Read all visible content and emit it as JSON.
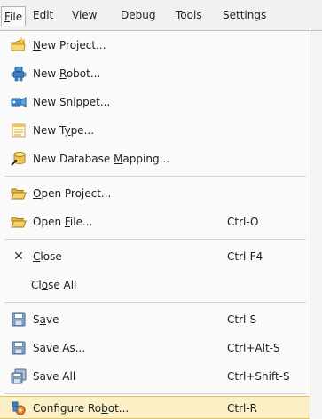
{
  "menubar": {
    "items": [
      {
        "pre": "",
        "m": "F",
        "post": "ile"
      },
      {
        "pre": "",
        "m": "E",
        "post": "dit"
      },
      {
        "pre": "",
        "m": "V",
        "post": "iew"
      },
      {
        "pre": "",
        "m": "D",
        "post": "ebug"
      },
      {
        "pre": "",
        "m": "T",
        "post": "ools"
      },
      {
        "pre": "",
        "m": "S",
        "post": "ettings"
      }
    ]
  },
  "file_menu": {
    "items": [
      {
        "icon": "new-project-icon",
        "pre": "",
        "m": "N",
        "post": "ew Project...",
        "shortcut": ""
      },
      {
        "icon": "new-robot-icon",
        "pre": "New ",
        "m": "R",
        "post": "obot...",
        "shortcut": ""
      },
      {
        "icon": "new-snippet-icon",
        "pre": "New Snippet...",
        "m": "",
        "post": "",
        "shortcut": ""
      },
      {
        "icon": "new-type-icon",
        "pre": "New T",
        "m": "y",
        "post": "pe...",
        "shortcut": ""
      },
      {
        "icon": "new-database-mapping-icon",
        "pre": "New Database ",
        "m": "M",
        "post": "apping...",
        "shortcut": ""
      },
      {
        "icon": "open-folder-icon",
        "pre": "",
        "m": "O",
        "post": "pen Project...",
        "shortcut": ""
      },
      {
        "icon": "open-folder-icon",
        "pre": "Open ",
        "m": "F",
        "post": "ile...",
        "shortcut": "Ctrl-O"
      },
      {
        "icon": "close-icon",
        "glyph": "✕",
        "pre": "",
        "m": "C",
        "post": "lose",
        "shortcut": "Ctrl-F4"
      },
      {
        "icon": "",
        "pre": "Cl",
        "m": "o",
        "post": "se All",
        "shortcut": ""
      },
      {
        "icon": "save-icon",
        "pre": "S",
        "m": "a",
        "post": "ve",
        "shortcut": "Ctrl-S"
      },
      {
        "icon": "save-as-icon",
        "pre": "Save As...",
        "m": "",
        "post": "",
        "shortcut": "Ctrl+Alt-S"
      },
      {
        "icon": "save-all-icon",
        "pre": "Save All",
        "m": "",
        "post": "",
        "shortcut": "Ctrl+Shift-S"
      },
      {
        "icon": "configure-robot-icon",
        "pre": "Configure Ro",
        "m": "b",
        "post": "ot...",
        "shortcut": "Ctrl-R"
      }
    ]
  }
}
